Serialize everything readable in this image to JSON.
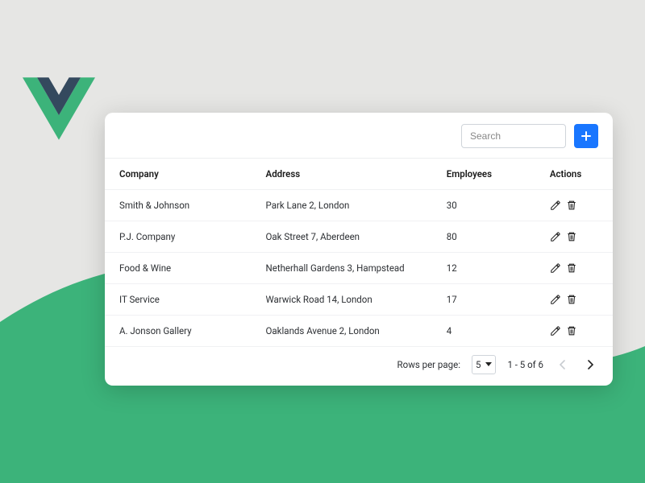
{
  "search": {
    "placeholder": "Search"
  },
  "columns": {
    "company": "Company",
    "address": "Address",
    "employees": "Employees",
    "actions": "Actions"
  },
  "rows": [
    {
      "company": "Smith & Johnson",
      "address": "Park Lane 2, London",
      "employees": "30"
    },
    {
      "company": "P.J. Company",
      "address": "Oak Street 7, Aberdeen",
      "employees": "80"
    },
    {
      "company": "Food & Wine",
      "address": "Netherhall Gardens 3, Hampstead",
      "employees": "12"
    },
    {
      "company": "IT Service",
      "address": "Warwick Road 14, London",
      "employees": "17"
    },
    {
      "company": "A. Jonson Gallery",
      "address": "Oaklands Avenue 2, London",
      "employees": "4"
    }
  ],
  "footer": {
    "rows_per_page_label": "Rows per page:",
    "rows_per_page_value": "5",
    "range_label": "1 - 5 of 6"
  },
  "colors": {
    "accent_green": "#3cb37a",
    "vue_dark": "#34495e",
    "primary_blue": "#1976ff"
  }
}
